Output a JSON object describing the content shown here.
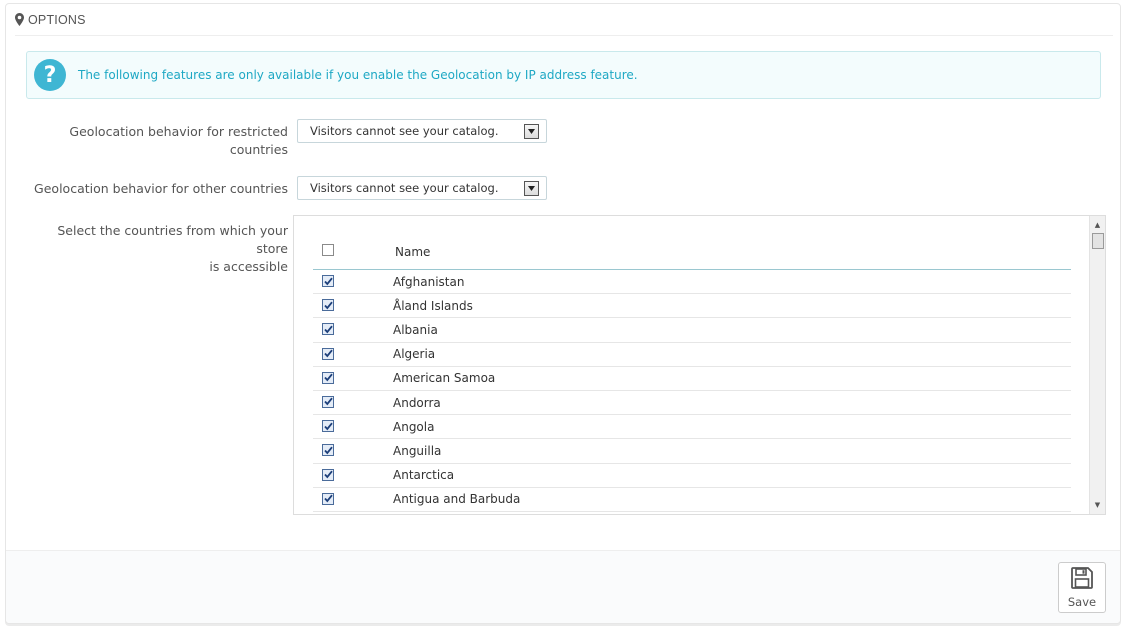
{
  "panel": {
    "heading": "OPTIONS"
  },
  "alert": {
    "text": "The following features are only available if you enable the Geolocation by IP address feature."
  },
  "fields": {
    "restricted_label_line1": "Geolocation behavior for restricted",
    "restricted_label_line2": "countries",
    "restricted_value": "Visitors cannot see your catalog.",
    "other_label": "Geolocation behavior for other countries",
    "other_value": "Visitors cannot see your catalog.",
    "countries_label_line1": "Select the countries from which your store",
    "countries_label_line2": "is accessible"
  },
  "country_table": {
    "header": "Name",
    "select_all_checked": false,
    "rows": [
      {
        "name": "Afghanistan",
        "checked": true
      },
      {
        "name": "Åland Islands",
        "checked": true
      },
      {
        "name": "Albania",
        "checked": true
      },
      {
        "name": "Algeria",
        "checked": true
      },
      {
        "name": "American Samoa",
        "checked": true
      },
      {
        "name": "Andorra",
        "checked": true
      },
      {
        "name": "Angola",
        "checked": true
      },
      {
        "name": "Anguilla",
        "checked": true
      },
      {
        "name": "Antarctica",
        "checked": true
      },
      {
        "name": "Antigua and Barbuda",
        "checked": true
      }
    ]
  },
  "footer": {
    "save_label": "Save"
  },
  "colors": {
    "accent": "#1ea8c4",
    "help_icon": "#3fb6d3",
    "alert_bg": "#f3fcfd"
  },
  "icons": {
    "heading": "map-marker-icon",
    "alert": "question-circle-icon",
    "save": "floppy-disk-icon",
    "select": "chevron-down-icon"
  }
}
